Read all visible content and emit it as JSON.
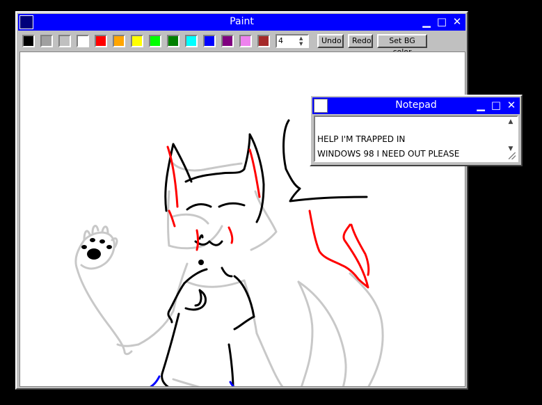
{
  "paint": {
    "title": "Paint",
    "controls": {
      "minimize": "▁",
      "maximize": "□",
      "close": "✕"
    },
    "palette": [
      {
        "name": "black",
        "color": "#000000"
      },
      {
        "name": "gray",
        "color": "#a0a0a0"
      },
      {
        "name": "silver",
        "color": "#c0c0c0"
      },
      {
        "name": "white",
        "color": "#ffffff"
      },
      {
        "name": "red",
        "color": "#ff0000"
      },
      {
        "name": "orange",
        "color": "#ffa500"
      },
      {
        "name": "yellow",
        "color": "#ffff00"
      },
      {
        "name": "lime",
        "color": "#00ff00"
      },
      {
        "name": "green",
        "color": "#008000"
      },
      {
        "name": "cyan",
        "color": "#00ffff"
      },
      {
        "name": "blue",
        "color": "#0000ff"
      },
      {
        "name": "purple",
        "color": "#800080"
      },
      {
        "name": "pink",
        "color": "#ee82ee"
      },
      {
        "name": "brown",
        "color": "#a52a2a"
      }
    ],
    "brush_size": "4",
    "undo_label": "Undo",
    "redo_label": "Redo",
    "set_bg_label": "Set BG color"
  },
  "notepad": {
    "title": "Notepad",
    "controls": {
      "minimize": "▁",
      "maximize": "□",
      "close": "✕"
    },
    "lines": [
      "HELP I'M TRAPPED IN",
      "WINDOWS 98 I NEED OUT PLEASE"
    ]
  }
}
